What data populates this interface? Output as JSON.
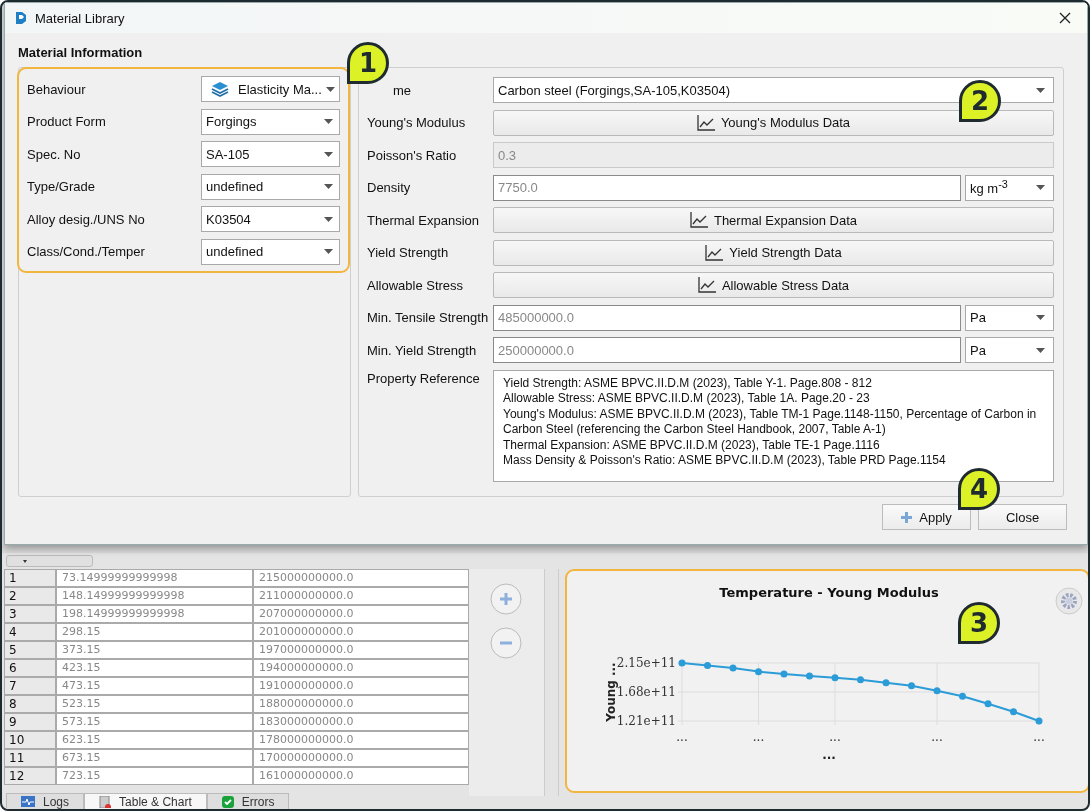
{
  "window": {
    "title": "Material Library"
  },
  "section_title": "Material Information",
  "classification": [
    {
      "kind": "icon-select",
      "label": "Behaviour",
      "value": "Elasticity Ma..."
    },
    {
      "kind": "select",
      "label": "Product Form",
      "value": "Forgings"
    },
    {
      "kind": "select",
      "label": "Spec. No",
      "value": "SA-105"
    },
    {
      "kind": "select",
      "label": "Type/Grade",
      "value": "undefined"
    },
    {
      "kind": "select",
      "label": "Alloy desig./UNS No",
      "value": "K03504"
    },
    {
      "kind": "select",
      "label": "Class/Cond./Temper",
      "value": "undefined"
    }
  ],
  "properties": [
    {
      "kind": "select",
      "label": "me",
      "value": "Carbon steel (Forgings,SA-105,K03504)"
    },
    {
      "kind": "data-button",
      "label": "Young's Modulus",
      "value": "Young's Modulus Data"
    },
    {
      "kind": "readonly",
      "label": "Poisson's Ratio",
      "value": "0.3"
    },
    {
      "kind": "input-unit",
      "label": "Density",
      "value": "7750.0",
      "unit": "kg m$^{-3}$"
    },
    {
      "kind": "data-button",
      "label": "Thermal Expansion",
      "value": "Thermal Expansion Data"
    },
    {
      "kind": "data-button",
      "label": "Yield Strength",
      "value": "Yield Strength Data"
    },
    {
      "kind": "data-button",
      "label": "Allowable Stress",
      "value": "Allowable Stress Data"
    },
    {
      "kind": "input-unit",
      "label": "Min. Tensile Strength",
      "value": "485000000.0",
      "unit": "Pa"
    },
    {
      "kind": "input-unit",
      "label": "Min. Yield Strength",
      "value": "250000000.0",
      "unit": "Pa"
    },
    {
      "kind": "text-area",
      "label": "Property Reference",
      "lines": [
        "Yield Strength: ASME BPVC.II.D.M (2023), Table Y-1. Page.808 - 812",
        "Allowable Stress: ASME BPVC.II.D.M (2023), Table 1A. Page.20 - 23",
        "Young's Modulus: ASME BPVC.II.D.M (2023), Table TM-1 Page.1148-1150, Percentage of Carbon in Carbon Steel (referencing the Carbon Steel Handbook, 2007, Table A-1)",
        "Thermal Expansion: ASME BPVC.II.D.M (2023), Table TE-1 Page.1116",
        "Mass Density & Poisson's Ratio: ASME BPVC.II.D.M (2023), Table PRD Page.1154"
      ]
    }
  ],
  "buttons": [
    {
      "kind": "apply",
      "label": "Apply"
    },
    {
      "kind": "plain",
      "label": "Close"
    }
  ],
  "markers": [
    {
      "label": "1"
    },
    {
      "label": "2"
    },
    {
      "label": "4"
    },
    {
      "label": "3"
    }
  ],
  "table": {
    "rows": [
      {
        "index": "1",
        "cells": [
          "73.14999999999998",
          "215000000000.0"
        ]
      },
      {
        "index": "2",
        "cells": [
          "148.14999999999998",
          "211000000000.0"
        ]
      },
      {
        "index": "3",
        "cells": [
          "198.14999999999998",
          "207000000000.0"
        ]
      },
      {
        "index": "4",
        "cells": [
          "298.15",
          "201000000000.0"
        ]
      },
      {
        "index": "5",
        "cells": [
          "373.15",
          "197000000000.0"
        ]
      },
      {
        "index": "6",
        "cells": [
          "423.15",
          "194000000000.0"
        ]
      },
      {
        "index": "7",
        "cells": [
          "473.15",
          "191000000000.0"
        ]
      },
      {
        "index": "8",
        "cells": [
          "523.15",
          "188000000000.0"
        ]
      },
      {
        "index": "9",
        "cells": [
          "573.15",
          "183000000000.0"
        ]
      },
      {
        "index": "10",
        "cells": [
          "623.15",
          "178000000000.0"
        ]
      },
      {
        "index": "11",
        "cells": [
          "673.15",
          "170000000000.0"
        ]
      },
      {
        "index": "12",
        "cells": [
          "723.15",
          "161000000000.0"
        ]
      }
    ]
  },
  "chart": {
    "chart_data": {
      "type": "line",
      "title": "Temperature - Young Modulus",
      "xlabel": "...",
      "ylabel": "Young ...",
      "categories": [
        "...",
        null,
        null,
        "...",
        null,
        null,
        "...",
        null,
        null,
        null,
        "...",
        null,
        null,
        null,
        "..."
      ],
      "series": [
        {
          "marker": "circle",
          "color": "#2b9cd8",
          "values": [
            215000000000,
            211000000000,
            207000000000,
            201000000000,
            197000000000,
            194000000000,
            191000000000,
            188000000000,
            183000000000,
            178000000000,
            170000000000,
            161000000000,
            149000000000,
            136000000000,
            121000000000
          ]
        }
      ],
      "ylim": [
        121000000000,
        215000000000
      ],
      "grid": true,
      "yticks": [
        {
          "value": 121000000000,
          "label": "1.21e+11"
        },
        {
          "value": 168000000000,
          "label": "1.68e+11"
        },
        {
          "value": 215000000000,
          "label": "2.15e+11"
        }
      ]
    }
  },
  "bottom_tabs": [
    {
      "kind": "logs",
      "label": "Logs",
      "selected": false
    },
    {
      "kind": "table",
      "label": "Table & Chart",
      "selected": true
    },
    {
      "kind": "errors",
      "label": "Errors",
      "selected": false
    }
  ]
}
